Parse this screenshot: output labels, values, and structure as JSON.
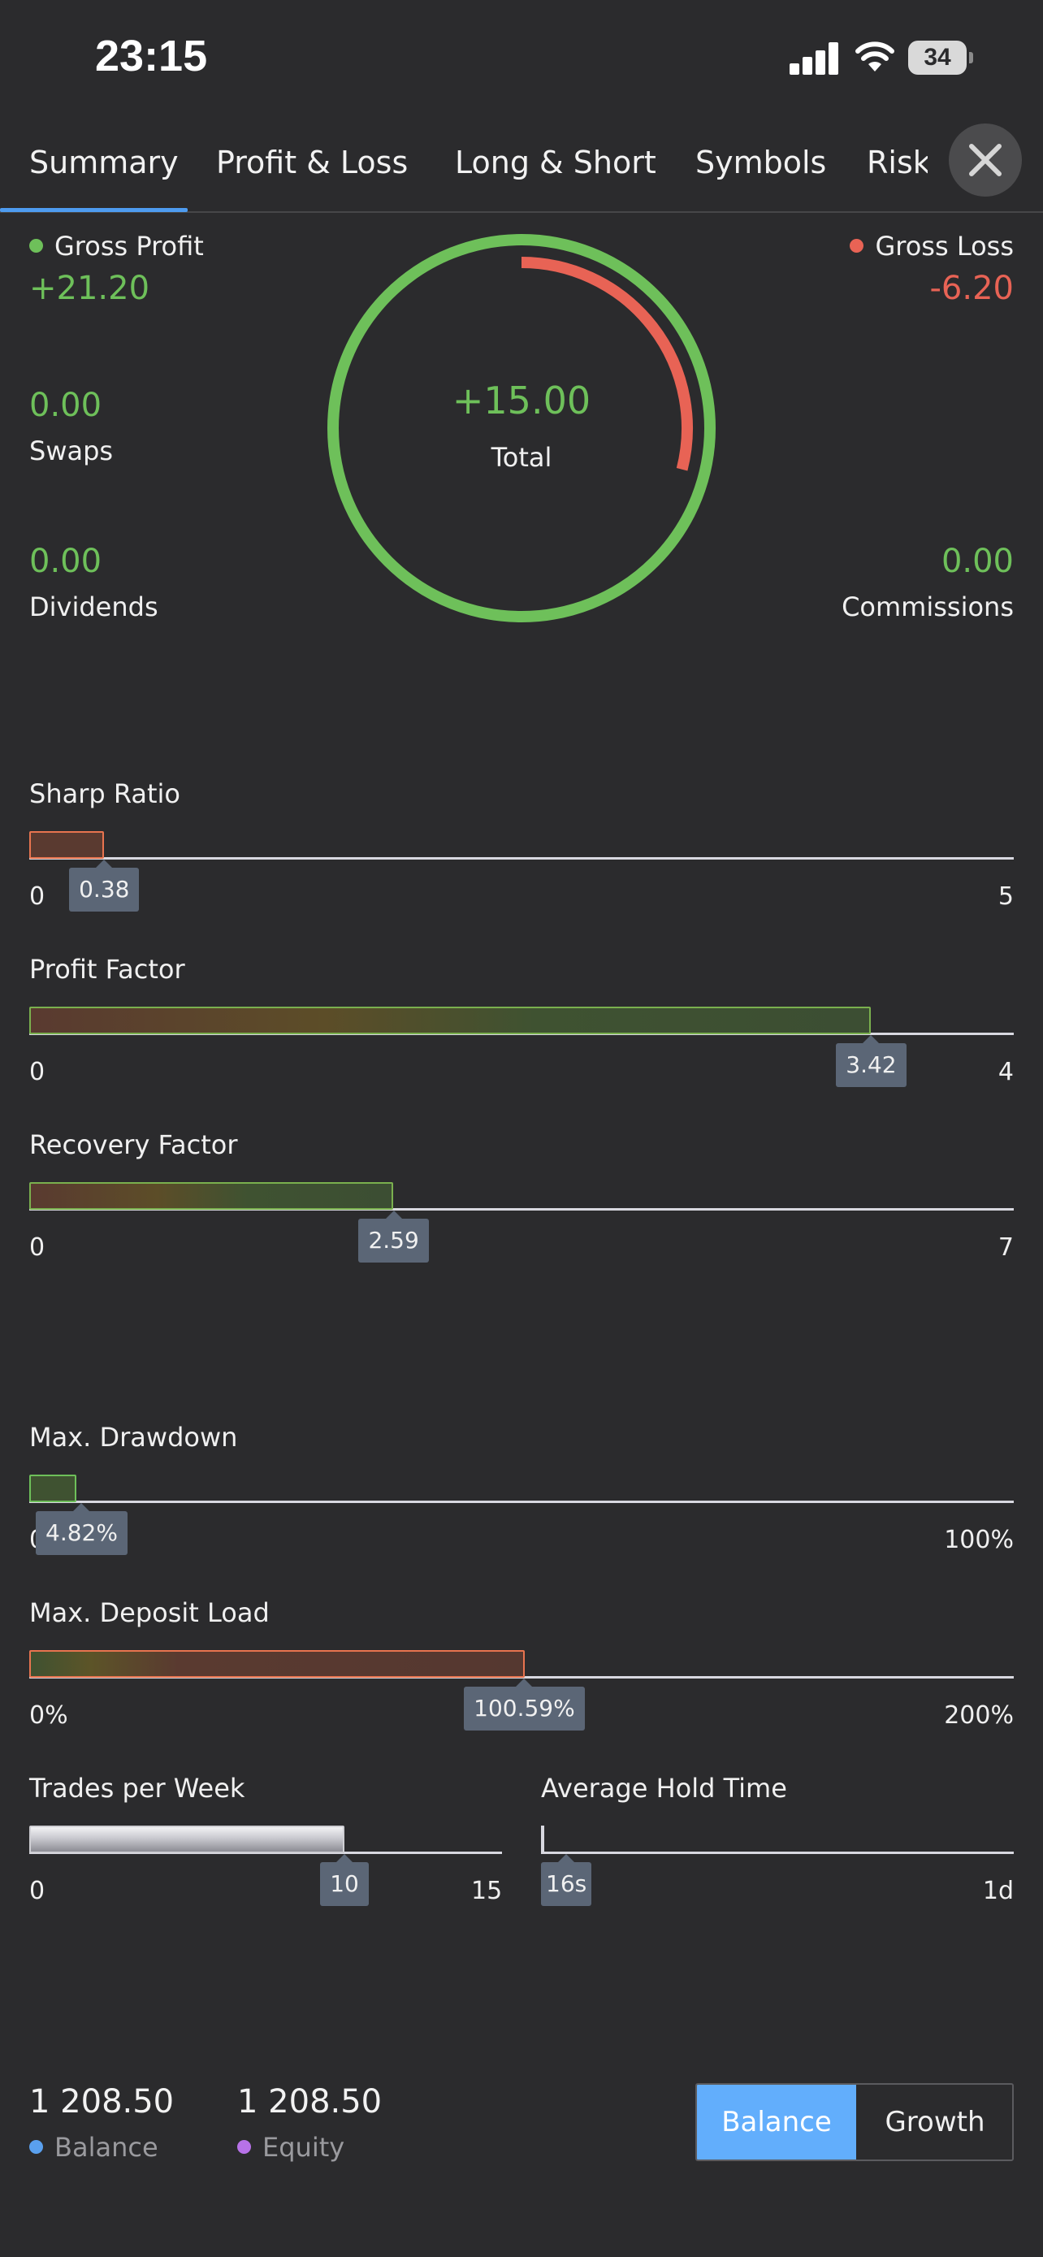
{
  "status_bar": {
    "time": "23:15",
    "battery": "34"
  },
  "tabs": [
    {
      "label": "Summary",
      "active": true
    },
    {
      "label": "Profit & Loss"
    },
    {
      "label": "Long & Short"
    },
    {
      "label": "Symbols"
    },
    {
      "label": "Risks"
    }
  ],
  "summary": {
    "gross_profit": {
      "label": "Gross Profit",
      "value": "+21.20"
    },
    "gross_loss": {
      "label": "Gross Loss",
      "value": "-6.20"
    },
    "swaps": {
      "label": "Swaps",
      "value": "0.00"
    },
    "dividends": {
      "label": "Dividends",
      "value": "0.00"
    },
    "commissions": {
      "label": "Commissions",
      "value": "0.00"
    },
    "total": {
      "label": "Total",
      "value": "+15.00"
    },
    "donut_loss_fraction": 0.29
  },
  "metrics": {
    "sharp_ratio": {
      "label": "Sharp Ratio",
      "value": "0.38",
      "min": "0",
      "max": "5",
      "fraction": 0.076
    },
    "profit_factor": {
      "label": "Profit Factor",
      "value": "3.42",
      "min": "0",
      "max": "4",
      "fraction": 0.855
    },
    "recovery_factor": {
      "label": "Recovery Factor",
      "value": "2.59",
      "min": "0",
      "max": "7",
      "fraction": 0.37
    },
    "max_drawdown": {
      "label": "Max. Drawdown",
      "value": "4.82%",
      "min": "0%",
      "max": "100%",
      "fraction": 0.0482
    },
    "max_deposit_load": {
      "label": "Max. Deposit Load",
      "value": "100.59%",
      "min": "0%",
      "max": "200%",
      "fraction": 0.503
    },
    "trades_per_week": {
      "label": "Trades per Week",
      "value": "10",
      "min": "0",
      "max": "15",
      "fraction": 0.667
    },
    "average_hold_time": {
      "label": "Average Hold Time",
      "value": "16s",
      "min": "16s",
      "max": "1d",
      "fraction": 0.0
    }
  },
  "colors": {
    "profit": "#6ec05a",
    "loss": "#e86355",
    "accent": "#4e9cf0",
    "balance": "#5aa0ee",
    "equity": "#b772e8"
  },
  "footer": {
    "balance": {
      "value": "1 208.50",
      "label": "Balance"
    },
    "equity": {
      "value": "1 208.50",
      "label": "Equity"
    },
    "toggle": [
      "Balance",
      "Growth"
    ]
  }
}
